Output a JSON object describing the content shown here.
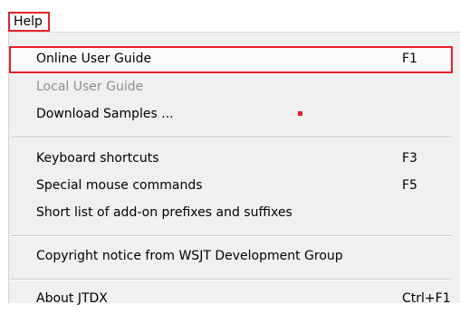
{
  "menu": {
    "title": "Help",
    "items": [
      {
        "label": "Online User Guide",
        "shortcut": "F1"
      },
      {
        "label": "Local User Guide",
        "shortcut": ""
      },
      {
        "label": "Download Samples ...",
        "shortcut": ""
      },
      {
        "label": "Keyboard shortcuts",
        "shortcut": "F3"
      },
      {
        "label": "Special mouse commands",
        "shortcut": "F5"
      },
      {
        "label": "Short list of add-on prefixes and suffixes",
        "shortcut": ""
      },
      {
        "label": "Copyright notice from WSJT Development Group",
        "shortcut": ""
      },
      {
        "label": "About JTDX",
        "shortcut": "Ctrl+F1"
      }
    ]
  },
  "colors": {
    "highlight_border": "#e8202a",
    "menu_background": "#f0f0f0",
    "disabled_text": "#8d8d8d"
  }
}
